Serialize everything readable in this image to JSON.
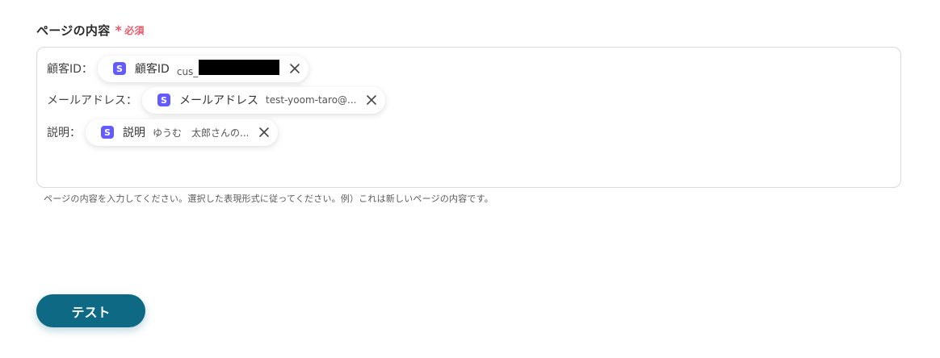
{
  "field": {
    "label": "ページの内容",
    "required_mark": "*",
    "required_text": "必須",
    "helper": "ページの内容を入力してください。選択した表現形式に従ってください。例）これは新しいページの内容です。"
  },
  "rows": [
    {
      "label": "顧客ID：",
      "token": {
        "icon": "S",
        "name": "顧客ID",
        "value": "cus_"
      }
    },
    {
      "label": "メールアドレス：",
      "token": {
        "icon": "S",
        "name": "メールアドレス",
        "value": "test-yoom-taro@..."
      }
    },
    {
      "label": "説明：",
      "token": {
        "icon": "S",
        "name": "説明",
        "value": "ゆうむ　太郎さんの..."
      }
    }
  ],
  "button": {
    "label": "テスト"
  },
  "colors": {
    "accent": "#0e6a84",
    "required": "#e8586a",
    "token_icon": "#635bff"
  }
}
